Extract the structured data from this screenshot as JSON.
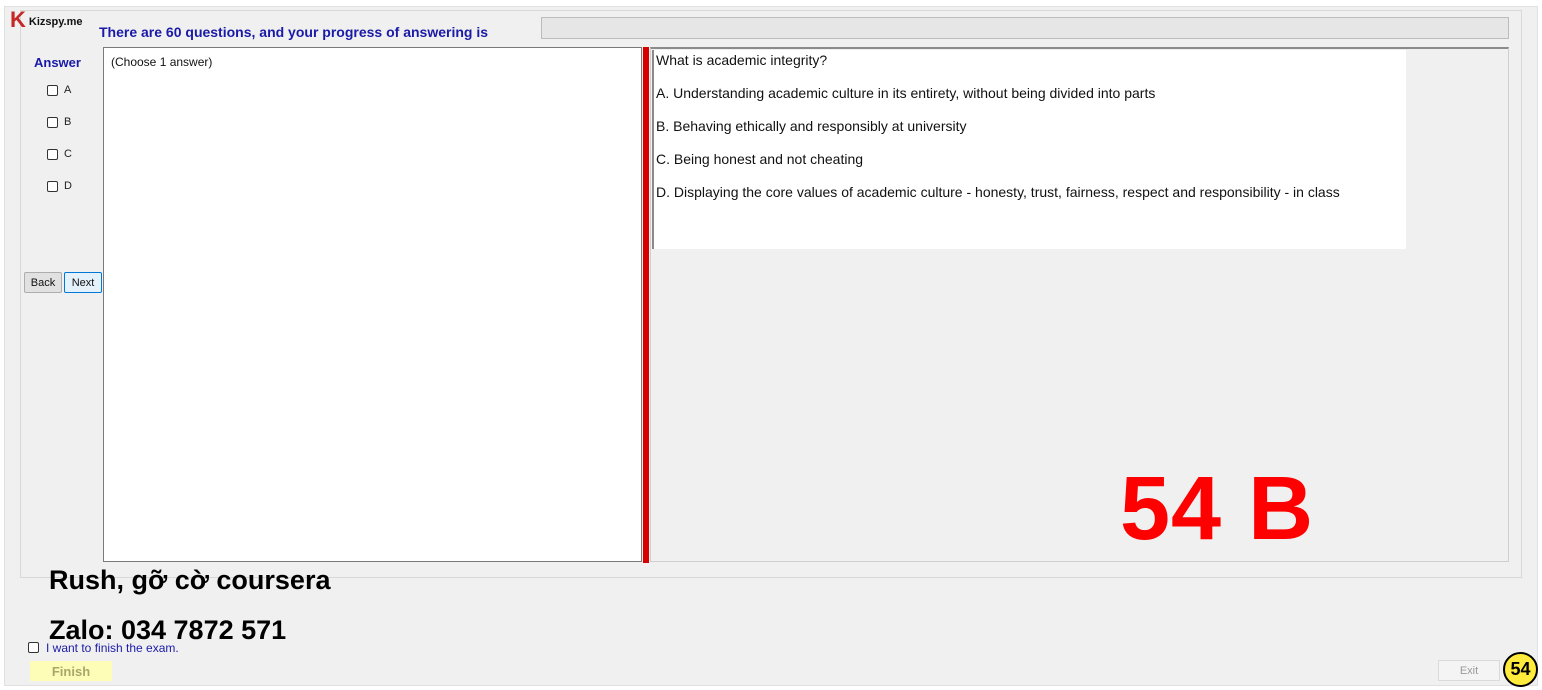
{
  "app": {
    "logo_text": "Kizspy.me",
    "logo_letter": "K"
  },
  "header": {
    "progress_label": "There are 60 questions, and your progress of answering is",
    "progress_fraction": 0
  },
  "answer_panel": {
    "title": "Answer",
    "options": [
      {
        "label": "A",
        "checked": false
      },
      {
        "label": "B",
        "checked": false
      },
      {
        "label": "C",
        "checked": false
      },
      {
        "label": "D",
        "checked": false
      }
    ],
    "back_label": "Back",
    "next_label": "Next"
  },
  "left_box": {
    "instruction": "(Choose 1 answer)"
  },
  "question": {
    "text": "What is academic integrity?",
    "choices": [
      "A.  Understanding academic culture in its entirety, without being divided into parts",
      "B.  Behaving ethically and responsibly at university",
      "C.  Being honest and not cheating",
      "D.  Displaying the core values of academic culture - honesty, trust, fairness, respect and responsibility - in class"
    ]
  },
  "overlay": {
    "answer_mark": "54 B",
    "line1": "Rush, gỡ cờ coursera",
    "line2": "Zalo: 034 7872 571",
    "color": "#ff0000"
  },
  "footer": {
    "finish_checkbox_label": "I want to finish the exam.",
    "finish_label": "Finish",
    "exit_label": "Exit",
    "badge": "54"
  },
  "colors": {
    "accent_blue": "#1a1aa8",
    "divider_red": "#d60000",
    "finish_bg": "#fdfdb8",
    "badge_yellow": "#ffeb3b"
  }
}
